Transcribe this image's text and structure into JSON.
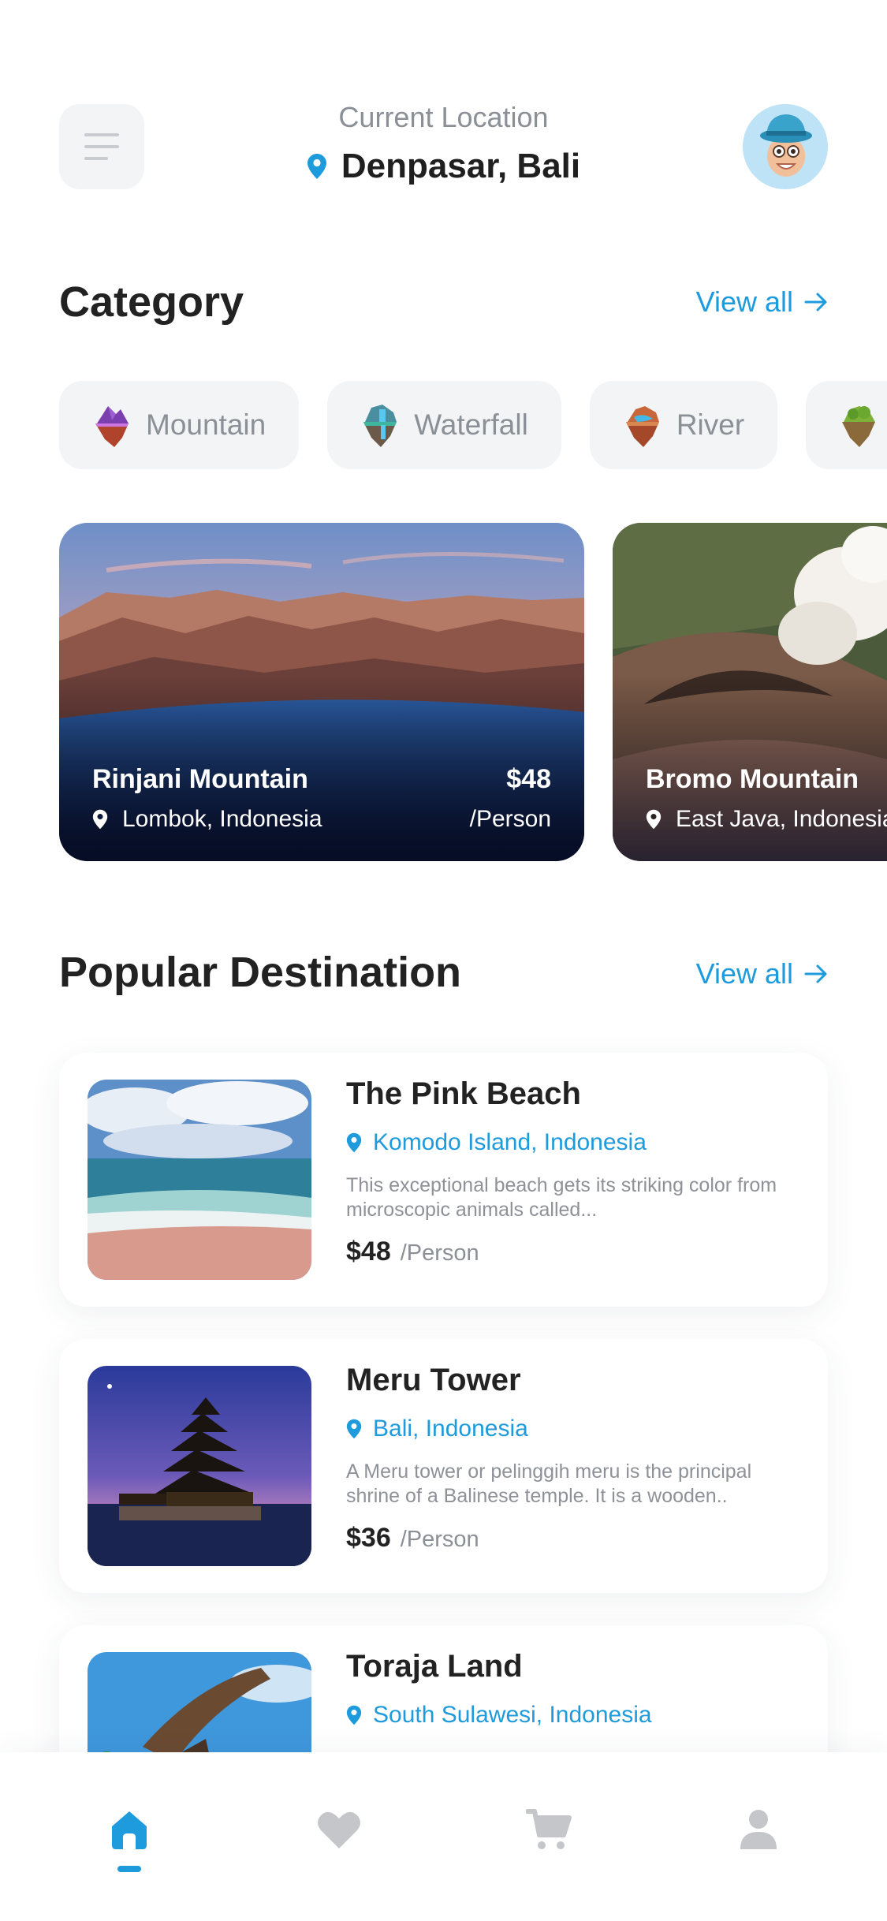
{
  "header": {
    "caption": "Current Location",
    "city": "Denpasar, Bali"
  },
  "category": {
    "title": "Category",
    "view_all": "View all",
    "chips": [
      {
        "label": "Mountain",
        "icon": "mountain-island-icon"
      },
      {
        "label": "Waterfall",
        "icon": "waterfall-island-icon"
      },
      {
        "label": "River",
        "icon": "river-island-icon"
      },
      {
        "label": "",
        "icon": "forest-island-icon"
      }
    ]
  },
  "featured": [
    {
      "name": "Rinjani Mountain",
      "location": "Lombok, Indonesia",
      "price": "$48",
      "unit": "/Person"
    },
    {
      "name": "Bromo Mountain",
      "location": "East Java, Indonesia",
      "price": "",
      "unit": ""
    }
  ],
  "popular": {
    "title": "Popular Destination",
    "view_all": "View all",
    "items": [
      {
        "name": "The Pink Beach",
        "location": "Komodo Island, Indonesia",
        "description": "This exceptional beach gets its striking color from microscopic animals called...",
        "price": "$48",
        "unit": "/Person"
      },
      {
        "name": "Meru Tower",
        "location": "Bali, Indonesia",
        "description": "A Meru tower or pelinggih meru is the principal shrine of a Balinese temple. It is a wooden..",
        "price": "$36",
        "unit": "/Person"
      },
      {
        "name": "Toraja Land",
        "location": "South Sulawesi, Indonesia",
        "description": "",
        "price": "",
        "unit": ""
      }
    ]
  },
  "nav": {
    "items": [
      {
        "icon": "home-icon",
        "active": true
      },
      {
        "icon": "heart-icon",
        "active": false
      },
      {
        "icon": "cart-icon",
        "active": false
      },
      {
        "icon": "profile-icon",
        "active": false
      }
    ]
  },
  "colors": {
    "accent": "#1d9bdc",
    "text": "#222222",
    "muted": "#8b8f96",
    "chip_bg": "#f3f4f6"
  }
}
